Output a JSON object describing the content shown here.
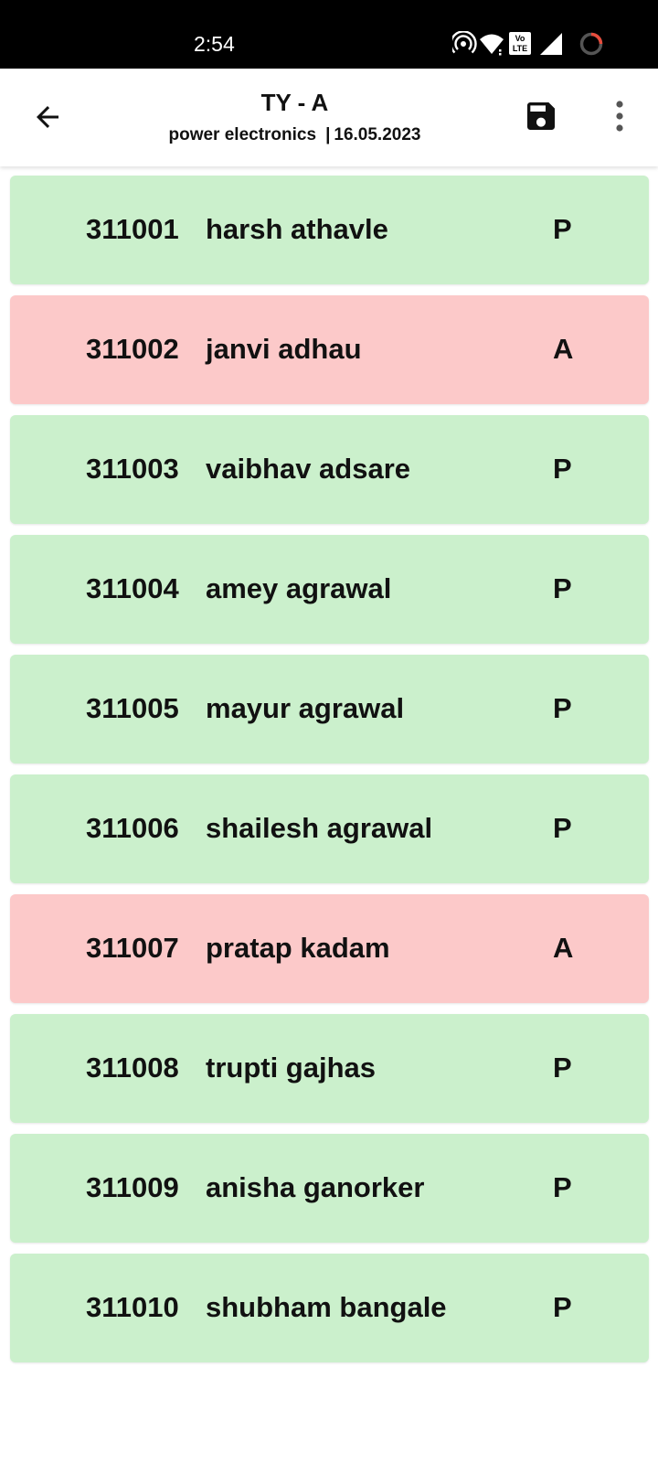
{
  "status_bar": {
    "time": "2:54",
    "icons": [
      "hotspot-icon",
      "wifi-icon",
      "volte-icon",
      "signal-icon",
      "battery-icon"
    ],
    "volte_label": "Vo LTE"
  },
  "app_bar": {
    "title": "TY - A",
    "subject": "power electronics",
    "separator": "|",
    "date": "16.05.2023",
    "back_icon": "arrow-back-icon",
    "save_icon": "save-icon",
    "more_icon": "more-vert-icon"
  },
  "colors": {
    "present": "#cbf0cc",
    "absent": "#fcc9c9"
  },
  "students": [
    {
      "roll": "311001",
      "name": "harsh athavle",
      "status": "P"
    },
    {
      "roll": "311002",
      "name": "janvi adhau",
      "status": "A"
    },
    {
      "roll": "311003",
      "name": "vaibhav adsare",
      "status": "P"
    },
    {
      "roll": "311004",
      "name": "amey agrawal",
      "status": "P"
    },
    {
      "roll": "311005",
      "name": "mayur agrawal",
      "status": "P"
    },
    {
      "roll": "311006",
      "name": "shailesh agrawal",
      "status": "P"
    },
    {
      "roll": "311007",
      "name": "pratap kadam",
      "status": "A"
    },
    {
      "roll": "311008",
      "name": "trupti gajhas",
      "status": "P"
    },
    {
      "roll": "311009",
      "name": "anisha ganorker",
      "status": "P"
    },
    {
      "roll": "311010",
      "name": "shubham bangale",
      "status": "P"
    }
  ]
}
